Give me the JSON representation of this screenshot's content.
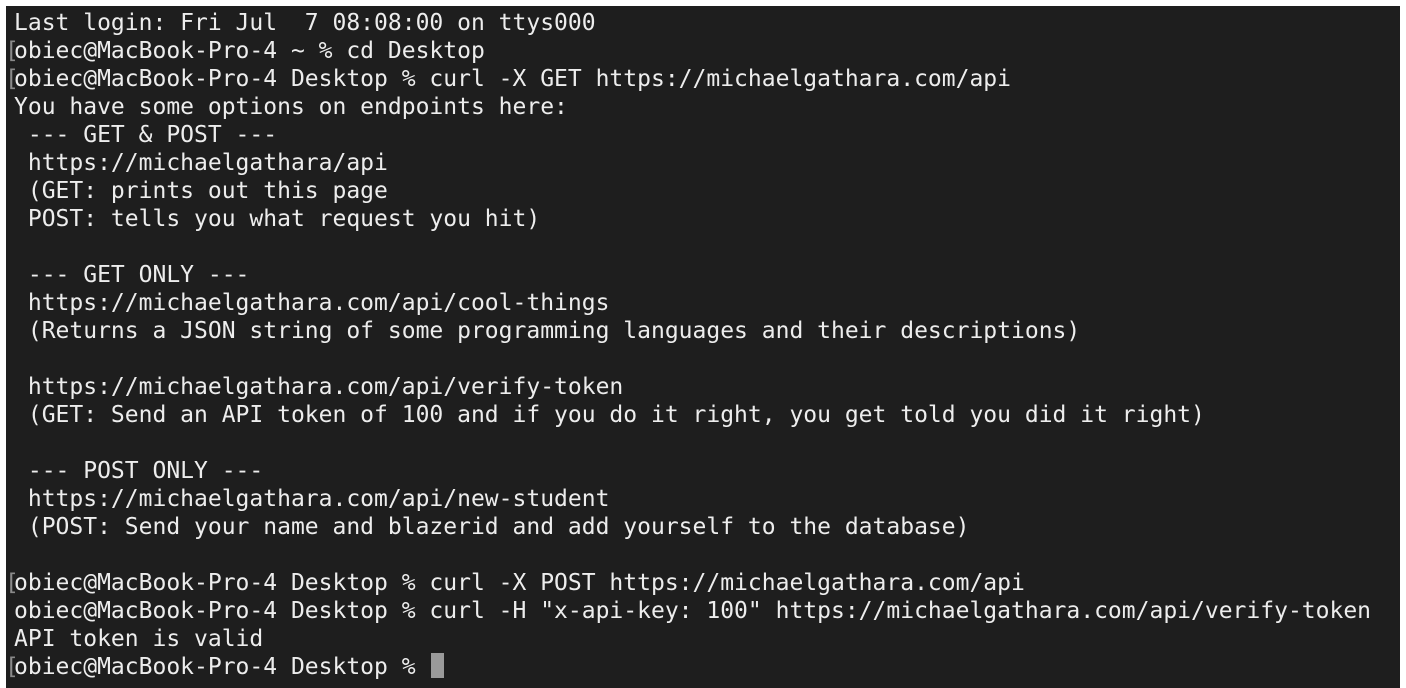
{
  "terminal": {
    "lines": [
      {
        "text": "Last login: Fri Jul  7 08:08:00 on ttys000",
        "mark": false
      },
      {
        "text": "obiec@MacBook-Pro-4 ~ % cd Desktop",
        "mark": true
      },
      {
        "text": "obiec@MacBook-Pro-4 Desktop % curl -X GET https://michaelgathara.com/api",
        "mark": true
      },
      {
        "text": "You have some options on endpoints here:",
        "mark": false
      },
      {
        "text": " --- GET & POST ---",
        "mark": false
      },
      {
        "text": " https://michaelgathara/api",
        "mark": false
      },
      {
        "text": " (GET: prints out this page",
        "mark": false
      },
      {
        "text": " POST: tells you what request you hit)",
        "mark": false
      },
      {
        "text": "",
        "mark": false
      },
      {
        "text": " --- GET ONLY ---",
        "mark": false
      },
      {
        "text": " https://michaelgathara.com/api/cool-things",
        "mark": false
      },
      {
        "text": " (Returns a JSON string of some programming languages and their descriptions)",
        "mark": false
      },
      {
        "text": "",
        "mark": false
      },
      {
        "text": " https://michaelgathara.com/api/verify-token",
        "mark": false
      },
      {
        "text": " (GET: Send an API token of 100 and if you do it right, you get told you did it right)",
        "mark": false
      },
      {
        "text": "",
        "mark": false
      },
      {
        "text": " --- POST ONLY ---",
        "mark": false
      },
      {
        "text": " https://michaelgathara.com/api/new-student",
        "mark": false
      },
      {
        "text": " (POST: Send your name and blazerid and add yourself to the database)",
        "mark": false
      },
      {
        "text": "",
        "mark": false
      },
      {
        "text": "obiec@MacBook-Pro-4 Desktop % curl -X POST https://michaelgathara.com/api",
        "mark": true
      },
      {
        "text": "obiec@MacBook-Pro-4 Desktop % curl -H \"x-api-key: 100\" https://michaelgathara.com/api/verify-token",
        "mark": false
      },
      {
        "text": "API token is valid",
        "mark": false
      },
      {
        "text": "obiec@MacBook-Pro-4 Desktop % ",
        "mark": true,
        "cursor": true
      }
    ],
    "mark_glyph": "[",
    "colors": {
      "background": "#1e1e1e",
      "text": "#ededed",
      "cursor": "#9a9a9a"
    }
  }
}
